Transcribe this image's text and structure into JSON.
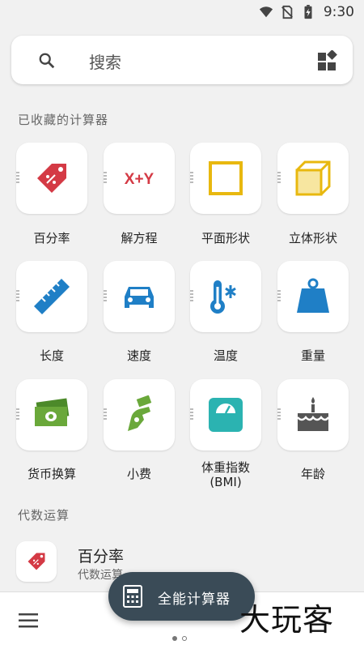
{
  "status_bar": {
    "time": "9:30"
  },
  "search": {
    "placeholder": "搜索"
  },
  "favorites": {
    "title": "已收藏的计算器",
    "items": [
      {
        "label": "百分率",
        "icon": "percent-tag-icon",
        "color": "#d43a45"
      },
      {
        "label": "解方程",
        "icon": "equation-xy-icon",
        "color": "#d43a45"
      },
      {
        "label": "平面形状",
        "icon": "square-icon",
        "color": "#e8b80f"
      },
      {
        "label": "立体形状",
        "icon": "cube-icon",
        "color": "#e8b80f"
      },
      {
        "label": "长度",
        "icon": "ruler-icon",
        "color": "#1f7fc6"
      },
      {
        "label": "速度",
        "icon": "car-icon",
        "color": "#1f7fc6"
      },
      {
        "label": "温度",
        "icon": "thermometer-icon",
        "color": "#1f7fc6"
      },
      {
        "label": "重量",
        "icon": "weight-icon",
        "color": "#1f7fc6"
      },
      {
        "label": "货币换算",
        "icon": "money-icon",
        "color": "#6aa83a"
      },
      {
        "label": "小费",
        "icon": "tip-hand-icon",
        "color": "#6aa83a"
      },
      {
        "label": "体重指数\n(BMI)",
        "icon": "scale-icon",
        "color": "#2bb3b1"
      },
      {
        "label": "年龄",
        "icon": "cake-icon",
        "color": "#555555"
      }
    ]
  },
  "algebra": {
    "title": "代数运算",
    "items": [
      {
        "title": "百分率",
        "subtitle": "代数运算",
        "icon": "percent-tag-icon"
      }
    ]
  },
  "fab": {
    "label": "全能计算器"
  },
  "watermark": "大玩客",
  "colors": {
    "fab_bg": "#3a4b57",
    "background": "#f1f1f1"
  }
}
